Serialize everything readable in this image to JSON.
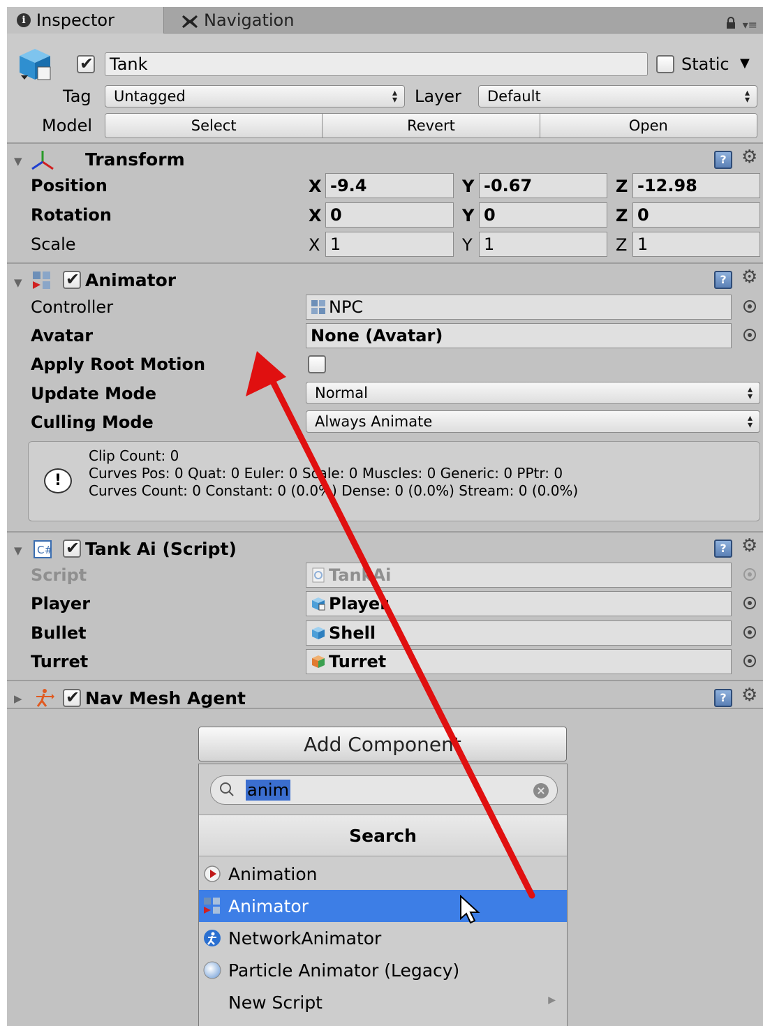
{
  "tabs": {
    "inspector": "Inspector",
    "navigation": "Navigation"
  },
  "header": {
    "object_name": "Tank",
    "active": true,
    "static_label": "Static",
    "static": false,
    "tag_label": "Tag",
    "tag_value": "Untagged",
    "layer_label": "Layer",
    "layer_value": "Default",
    "model_label": "Model",
    "model_buttons": [
      "Select",
      "Revert",
      "Open"
    ]
  },
  "transform": {
    "title": "Transform",
    "position_label": "Position",
    "rotation_label": "Rotation",
    "scale_label": "Scale",
    "axes": [
      "X",
      "Y",
      "Z"
    ],
    "position": [
      "-9.4",
      "-0.67",
      "-12.98"
    ],
    "rotation": [
      "0",
      "0",
      "0"
    ],
    "scale": [
      "1",
      "1",
      "1"
    ]
  },
  "animator": {
    "title": "Animator",
    "enabled": true,
    "controller_label": "Controller",
    "controller_value": "NPC",
    "avatar_label": "Avatar",
    "avatar_value": "None (Avatar)",
    "apply_root_motion_label": "Apply Root Motion",
    "apply_root_motion": false,
    "update_mode_label": "Update Mode",
    "update_mode_value": "Normal",
    "culling_mode_label": "Culling Mode",
    "culling_mode_value": "Always Animate",
    "info_lines": [
      "Clip Count: 0",
      "Curves Pos: 0 Quat: 0 Euler: 0 Scale: 0 Muscles: 0 Generic: 0 PPtr: 0",
      "Curves Count: 0 Constant: 0 (0.0%) Dense: 0 (0.0%) Stream: 0 (0.0%)"
    ]
  },
  "tank_ai": {
    "title": "Tank Ai (Script)",
    "enabled": true,
    "script_label": "Script",
    "script_value": "TankAi",
    "player_label": "Player",
    "player_value": "Player",
    "bullet_label": "Bullet",
    "bullet_value": "Shell",
    "turret_label": "Turret",
    "turret_value": "Turret"
  },
  "nav_mesh_agent": {
    "title": "Nav Mesh Agent",
    "enabled": true
  },
  "add_component": {
    "button_label": "Add Component",
    "search_text": "anim",
    "header": "Search",
    "items": [
      {
        "label": "Animation",
        "icon": "animation-icon"
      },
      {
        "label": "Animator",
        "icon": "animator-icon",
        "selected": true
      },
      {
        "label": "NetworkAnimator",
        "icon": "network-animator-icon"
      },
      {
        "label": "Particle Animator (Legacy)",
        "icon": "particle-animator-icon"
      },
      {
        "label": "New Script",
        "icon": "",
        "submenu": true
      }
    ]
  },
  "colors": {
    "panel_bg": "#c2c2c2",
    "selection": "#3d7ee6",
    "annotation_arrow": "#e01010"
  }
}
